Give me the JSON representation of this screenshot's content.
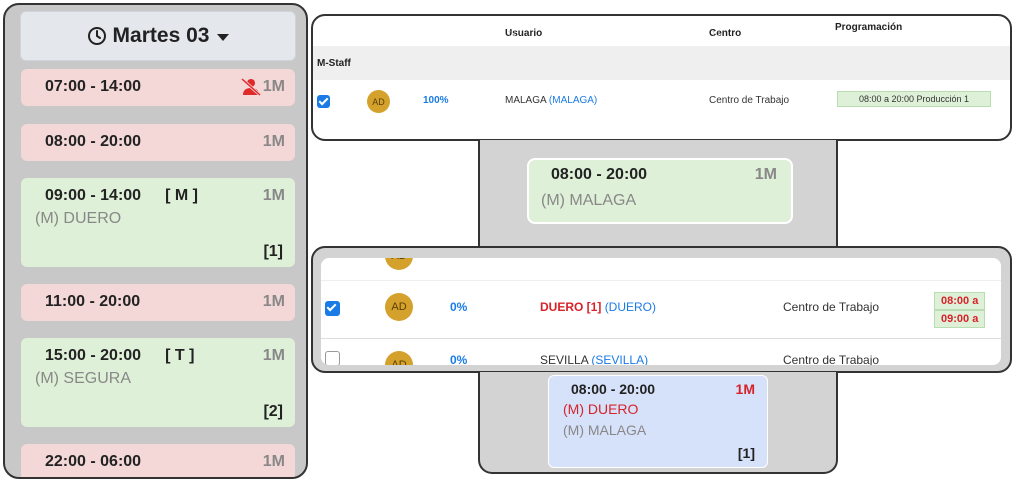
{
  "day_header": {
    "label": "Martes 03"
  },
  "slots": [
    {
      "time": "07:00 - 14:00",
      "shift": "",
      "count": "1M",
      "place": "",
      "bracket": "",
      "color": "red",
      "icon": "user-slash-icon"
    },
    {
      "time": "08:00 - 20:00",
      "shift": "",
      "count": "1M",
      "place": "",
      "bracket": "",
      "color": "red"
    },
    {
      "time": "09:00 - 14:00",
      "shift_open": "[",
      "shift_code": "M",
      "shift_close": "]",
      "count": "1M",
      "place": "(M) DUERO",
      "bracket": "[1]",
      "color": "green"
    },
    {
      "time": "11:00 - 20:00",
      "shift": "",
      "count": "1M",
      "place": "",
      "bracket": "",
      "color": "red"
    },
    {
      "time": "15:00 - 20:00",
      "shift_open": "[",
      "shift_code": "T",
      "shift_close": "]",
      "count": "1M",
      "place": "(M) SEGURA",
      "bracket": "[2]",
      "color": "green"
    },
    {
      "time": "22:00 - 06:00",
      "shift": "",
      "count": "1M",
      "place": "",
      "bracket": "",
      "color": "red"
    }
  ],
  "top_table": {
    "headers": {
      "usuario": "Usuario",
      "centro": "Centro",
      "programacion": "Programación",
      "sort": "↑↓"
    },
    "group_label": "M-Staff",
    "row": {
      "avatar": "AD",
      "percent": "100%",
      "user": "MALAGA",
      "user_link": "(MALAGA)",
      "centro": "Centro de Trabajo",
      "schedule": "08:00 a 20:00 Producción 1"
    }
  },
  "mid_card": {
    "time": "08:00 - 20:00",
    "count": "1M",
    "place": "(M) MALAGA"
  },
  "second_table": {
    "row0_avatar": "AD",
    "row1": {
      "avatar": "AD",
      "percent": "0%",
      "user": "DUERO [1]",
      "user_link": "(DUERO)",
      "centro": "Centro de Trabajo",
      "schedule1": "08:00 a",
      "schedule2": "09:00 a"
    },
    "row2": {
      "avatar": "AD",
      "percent": "0%",
      "user": "SEVILLA",
      "user_link": "(SEVILLA)",
      "centro": "Centro de Trabajo"
    }
  },
  "bottom_card": {
    "time": "08:00 - 20:00",
    "count": "1M",
    "place1": "(M) DUERO",
    "place2": "(M) MALAGA",
    "bracket": "[1]"
  },
  "colors": {
    "slot_red": "#f4d7d7",
    "slot_green": "#dff0d8",
    "card_blue": "#d6e2fa",
    "accent_blue": "#1a7be6",
    "alert_red": "#d8222a",
    "avatar_gold": "#d4a22c"
  }
}
